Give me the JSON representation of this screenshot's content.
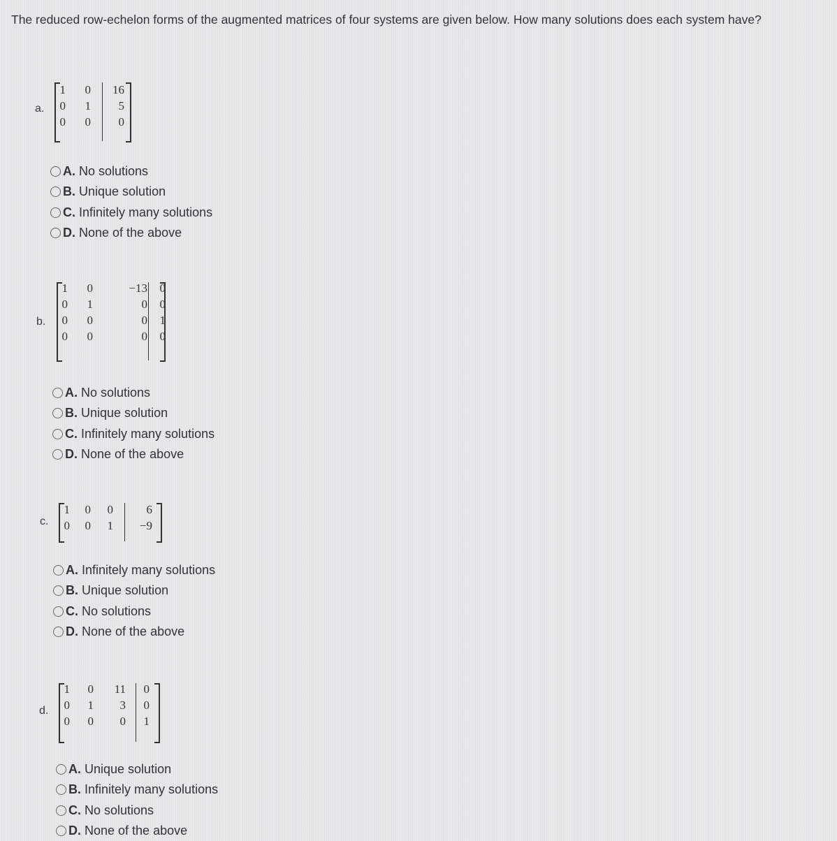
{
  "question": "The reduced row-echelon forms of the augmented matrices of four systems are given below. How many solutions does each system have?",
  "parts": [
    {
      "label": "a.",
      "matrix": [
        [
          "1",
          "0",
          "16"
        ],
        [
          "0",
          "1",
          "5"
        ],
        [
          "0",
          "0",
          "0"
        ]
      ],
      "options": [
        {
          "letter": "A.",
          "text": "No solutions"
        },
        {
          "letter": "B.",
          "text": "Unique solution"
        },
        {
          "letter": "C.",
          "text": "Infinitely many solutions"
        },
        {
          "letter": "D.",
          "text": "None of the above"
        }
      ]
    },
    {
      "label": "b.",
      "matrix": [
        [
          "1",
          "0",
          "−13",
          "0"
        ],
        [
          "0",
          "1",
          "0",
          "0"
        ],
        [
          "0",
          "0",
          "0",
          "1"
        ],
        [
          "0",
          "0",
          "0",
          "0"
        ]
      ],
      "options": [
        {
          "letter": "A.",
          "text": "No solutions"
        },
        {
          "letter": "B.",
          "text": "Unique solution"
        },
        {
          "letter": "C.",
          "text": "Infinitely many solutions"
        },
        {
          "letter": "D.",
          "text": "None of the above"
        }
      ]
    },
    {
      "label": "c.",
      "matrix": [
        [
          "1",
          "0",
          "0",
          "6"
        ],
        [
          "0",
          "0",
          "1",
          "−9"
        ]
      ],
      "options": [
        {
          "letter": "A.",
          "text": "Infinitely many solutions"
        },
        {
          "letter": "B.",
          "text": "Unique solution"
        },
        {
          "letter": "C.",
          "text": "No solutions"
        },
        {
          "letter": "D.",
          "text": "None of the above"
        }
      ]
    },
    {
      "label": "d.",
      "matrix": [
        [
          "1",
          "0",
          "11",
          "0"
        ],
        [
          "0",
          "1",
          "3",
          "0"
        ],
        [
          "0",
          "0",
          "0",
          "1"
        ]
      ],
      "options": [
        {
          "letter": "A.",
          "text": "Unique solution"
        },
        {
          "letter": "B.",
          "text": "Infinitely many solutions"
        },
        {
          "letter": "C.",
          "text": "No solutions"
        },
        {
          "letter": "D.",
          "text": "None of the above"
        }
      ]
    }
  ]
}
